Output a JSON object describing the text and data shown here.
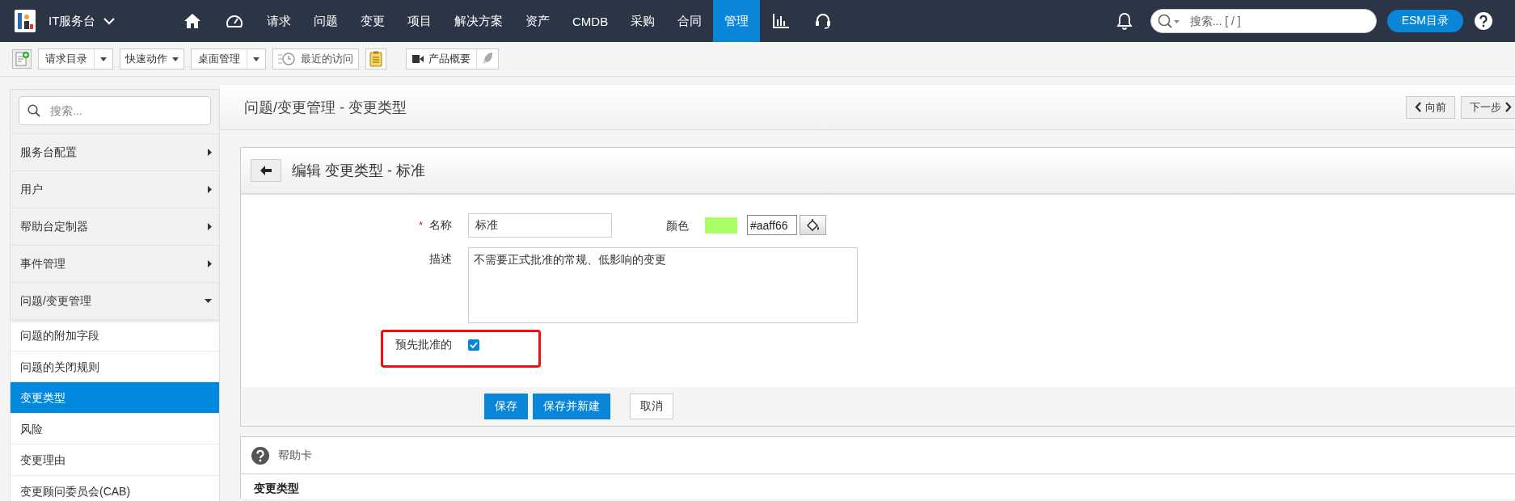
{
  "topbar": {
    "app_title": "IT服务台",
    "nav": [
      {
        "label": "请求",
        "selected": false
      },
      {
        "label": "问题",
        "selected": false
      },
      {
        "label": "变更",
        "selected": false
      },
      {
        "label": "项目",
        "selected": false
      },
      {
        "label": "解决方案",
        "selected": false
      },
      {
        "label": "资产",
        "selected": false
      },
      {
        "label": "CMDB",
        "selected": false
      },
      {
        "label": "采购",
        "selected": false
      },
      {
        "label": "合同",
        "selected": false
      },
      {
        "label": "管理",
        "selected": true
      }
    ],
    "search_placeholder": "搜索... [ / ]",
    "esm_button": "ESM目录"
  },
  "toolbar": {
    "buttons": [
      {
        "label": "请求目录",
        "kind": "split"
      },
      {
        "label": "快速动作",
        "kind": "dropdown"
      },
      {
        "label": "桌面管理",
        "kind": "split"
      },
      {
        "label": "最近的访问",
        "kind": "history"
      }
    ],
    "product_overview": "产品概要"
  },
  "sidebar": {
    "search_placeholder": "搜索...",
    "groups": [
      {
        "label": "服务台配置",
        "expanded": false
      },
      {
        "label": "用户",
        "expanded": false
      },
      {
        "label": "帮助台定制器",
        "expanded": false
      },
      {
        "label": "事件管理",
        "expanded": false
      },
      {
        "label": "问题/变更管理",
        "expanded": true,
        "children": [
          {
            "label": "问题的附加字段",
            "selected": false
          },
          {
            "label": "问题的关闭规则",
            "selected": false
          },
          {
            "label": "变更类型",
            "selected": true
          },
          {
            "label": "风险",
            "selected": false
          },
          {
            "label": "变更理由",
            "selected": false
          },
          {
            "label": "变更顾问委员会(CAB)",
            "selected": false
          }
        ]
      }
    ]
  },
  "content": {
    "title": "问题/变更管理 - 变更类型",
    "prev_button": "向前",
    "next_button": "下一步",
    "form": {
      "title": "编辑 变更类型 - 标准",
      "name": {
        "required_mark": "*",
        "label": "名称",
        "value": "标准"
      },
      "color": {
        "label": "颜色",
        "value": "#aaff66",
        "color": "#aaff66"
      },
      "description": {
        "label": "描述",
        "value": "不需要正式批准的常规、低影响的变更"
      },
      "pre_approved": {
        "label": "预先批准的",
        "checked": true
      },
      "buttons": [
        {
          "label": "保存",
          "kind": "primary"
        },
        {
          "label": "保存并新建",
          "kind": "primary"
        },
        {
          "label": "取消",
          "kind": "default"
        }
      ]
    },
    "help": {
      "title": "帮助卡",
      "heading": "变更类型"
    }
  }
}
